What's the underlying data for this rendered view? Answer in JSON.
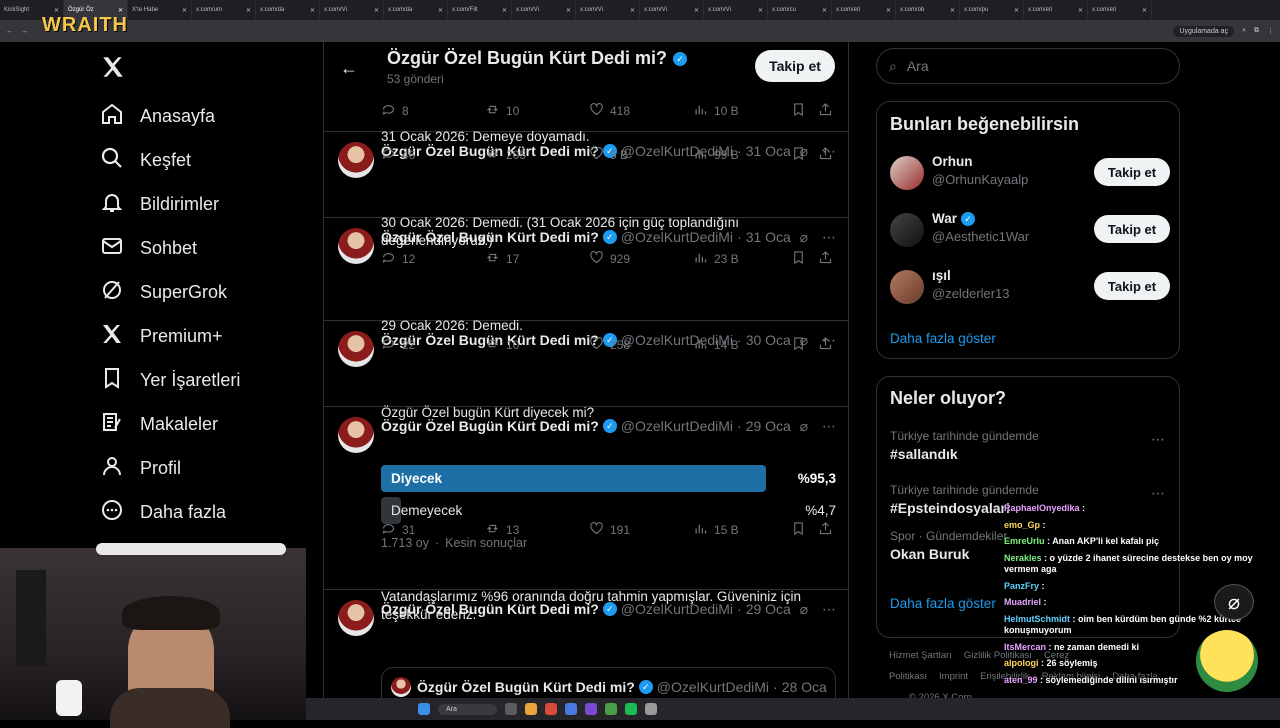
{
  "browser": {
    "tabs": [
      "KickSight",
      "Özgür Öz",
      "X'te Habe",
      "x.com/um",
      "x.com/da",
      "x.com/Vi",
      "x.com/da",
      "x.com/Filt",
      "x.com/Vi",
      "x.com/Vi",
      "x.com/Vi",
      "x.com/Vi",
      "x.com/cu",
      "x.com/eti",
      "x.com/ob",
      "x.com/pu",
      "x.com/eti",
      "x.com/eti"
    ],
    "active_tab_index": 1,
    "badge_label": "Uygulamada aç"
  },
  "overlay": {
    "brand": "WRAITH"
  },
  "nav": {
    "items": [
      {
        "label": "Anasayfa",
        "icon": "home-icon"
      },
      {
        "label": "Keşfet",
        "icon": "search-icon"
      },
      {
        "label": "Bildirimler",
        "icon": "bell-icon"
      },
      {
        "label": "Sohbet",
        "icon": "mail-icon"
      },
      {
        "label": "SuperGrok",
        "icon": "grok-icon"
      },
      {
        "label": "Premium+",
        "icon": "x-logo-icon"
      },
      {
        "label": "Yer İşaretleri",
        "icon": "bookmark-icon"
      },
      {
        "label": "Makaleler",
        "icon": "article-icon"
      },
      {
        "label": "Profil",
        "icon": "person-icon"
      },
      {
        "label": "Daha fazla",
        "icon": "more-circle-icon"
      }
    ]
  },
  "header": {
    "title": "Özgür Özel Bugün Kürt Dedi mi?",
    "subtitle": "53 gönderi",
    "follow_label": "Takip et"
  },
  "top_actions": {
    "replies": "8",
    "reposts": "10",
    "likes": "418",
    "views": "10 B"
  },
  "posts": [
    {
      "name": "Özgür Özel Bugün Kürt Dedi mi?",
      "handle": "@OzelKurtDediMi",
      "date": "31 Oca",
      "text": "31 Ocak 2026: Demeye doyamadı.",
      "replies": "46",
      "reposts": "205",
      "likes": "5 B",
      "views": "99 B"
    },
    {
      "name": "Özgür Özel Bugün Kürt Dedi mi?",
      "handle": "@OzelKurtDediMi",
      "date": "31 Oca",
      "text": "30 Ocak 2026: Demedi. (31 Ocak 2026 için güç toplandığını değerlendiriyoruz.)",
      "replies": "12",
      "reposts": "17",
      "likes": "929",
      "views": "23 B"
    },
    {
      "name": "Özgür Özel Bugün Kürt Dedi mi?",
      "handle": "@OzelKurtDediMi",
      "date": "30 Oca",
      "text": "29 Ocak 2026: Demedi.",
      "replies": "22",
      "reposts": "10",
      "likes": "258",
      "views": "14 B"
    },
    {
      "name": "Özgür Özel Bugün Kürt Dedi mi?",
      "handle": "@OzelKurtDediMi",
      "date": "29 Oca",
      "text": "Özgür Özel bugün Kürt diyecek mi?",
      "replies": "31",
      "reposts": "13",
      "likes": "191",
      "views": "15 B"
    },
    {
      "name": "Özgür Özel Bugün Kürt Dedi mi?",
      "handle": "@OzelKurtDediMi",
      "date": "29 Oca",
      "text": "Vatandaşlarımız %96 oranında doğru tahmin yapmışlar. Güveniniz için teşekkür ederiz."
    }
  ],
  "poll": {
    "options": [
      {
        "label": "Diyecek",
        "percent_label": "%95,3",
        "fraction": 0.953
      },
      {
        "label": "Demeyecek",
        "percent_label": "%4,7",
        "fraction": 0.047
      }
    ],
    "footer_votes": "1.713 oy",
    "footer_status": "Kesin sonuçlar"
  },
  "quoted": {
    "name": "Özgür Özel Bugün Kürt Dedi mi?",
    "handle": "@OzelKurtDediMi",
    "date": "28 Oca"
  },
  "right": {
    "search_placeholder": "Ara",
    "suggestions_title": "Bunları beğenebilirsin",
    "suggestions": [
      {
        "name": "Orhun",
        "handle": "@OrhunKayaalp",
        "verified": false
      },
      {
        "name": "War",
        "handle": "@Aesthetic1War",
        "verified": true
      },
      {
        "name": "ışıl",
        "handle": "@zelderler13",
        "verified": false
      }
    ],
    "follow_label": "Takip et",
    "show_more": "Daha fazla göster",
    "trends_title": "Neler oluyor?",
    "trends": [
      {
        "context": "Türkiye tarihinde gündemde",
        "name": "#sallandık"
      },
      {
        "context": "Türkiye tarihinde gündemde",
        "name": "#Epsteindosyalari"
      },
      {
        "context": "Spor · Gündemdekiler",
        "name": "Okan Buruk"
      }
    ],
    "trends_more": "Daha fazla göster",
    "footer_links": [
      "Hizmet Şartları",
      "Gizlilik Politikası",
      "Çerez Politikası",
      "Imprint",
      "Erişilebilirlik",
      "Reklam bilgisi",
      "Daha fazla ..."
    ],
    "copyright": "© 2026 X Corp."
  },
  "chat": [
    {
      "user": "RaphaelOnyedika",
      "msg": "",
      "cls": "u1"
    },
    {
      "user": "emo_Gp",
      "msg": "",
      "cls": "u4"
    },
    {
      "user": "EmreUrlu",
      "msg": "Anan AKP'li kel kafalı piç",
      "cls": "u2"
    },
    {
      "user": "Nerakles",
      "msg": "o yüzde 2 ihanet sürecine destekse ben oy moy vermem aga",
      "cls": "u2"
    },
    {
      "user": "PanzFry",
      "msg": "",
      "cls": "u3"
    },
    {
      "user": "Muadriel",
      "msg": "",
      "cls": "u1"
    },
    {
      "user": "HelmutSchmidt",
      "msg": "oim ben kürdüm ben günde %2 kürtce konuşmuyorum",
      "cls": "u3"
    },
    {
      "user": "ItsMercan",
      "msg": "ne zaman demedi ki",
      "cls": "u1"
    },
    {
      "user": "alpologi",
      "msg": "26 söylemiş",
      "cls": "u4"
    },
    {
      "user": "aten_99",
      "msg": "söylemediğinde dilini ısırmıştır",
      "cls": "u1"
    }
  ],
  "taskbar": {
    "search_label": "Ara"
  }
}
